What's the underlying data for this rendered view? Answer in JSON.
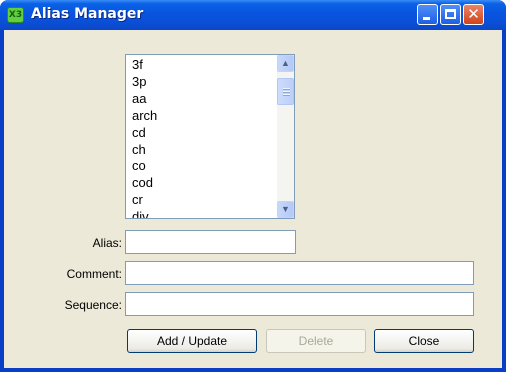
{
  "window": {
    "title": "Alias Manager",
    "app_icon_text": "X3"
  },
  "alias_list": {
    "items": [
      "3f",
      "3p",
      "aa",
      "arch",
      "cd",
      "ch",
      "co",
      "cod",
      "cr",
      "div"
    ]
  },
  "form": {
    "alias_label": "Alias:",
    "alias_value": "",
    "comment_label": "Comment:",
    "comment_value": "",
    "sequence_label": "Sequence:",
    "sequence_value": ""
  },
  "buttons": {
    "add_update": "Add / Update",
    "delete": "Delete",
    "close": "Close"
  },
  "colors": {
    "title_bar": "#0854e0",
    "window_bg": "#ece9d8",
    "close_button": "#d0431c",
    "disabled_text": "#aca899"
  }
}
